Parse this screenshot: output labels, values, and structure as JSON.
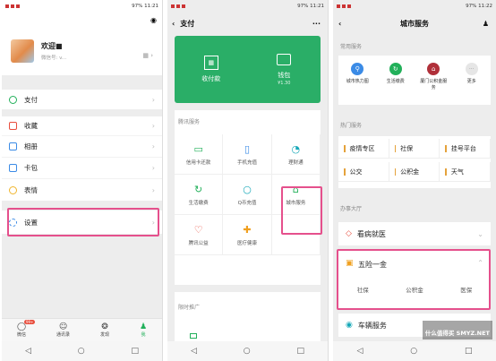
{
  "phone1": {
    "status": {
      "signal": "€☆ ⏰ ⋈ ↑",
      "battery": "97%",
      "time": "11:21"
    },
    "profile": {
      "name": "欢迎■",
      "wechat_id": "微信号: v..."
    },
    "menu": [
      {
        "label": "支付",
        "color": "#22b05a"
      },
      {
        "label": "收藏",
        "color": "#e84d3d"
      },
      {
        "label": "相册",
        "color": "#3b8be6"
      },
      {
        "label": "卡包",
        "color": "#3b8be6"
      },
      {
        "label": "表情",
        "color": "#f0b52c"
      },
      {
        "label": "设置",
        "color": "#3b8be6"
      }
    ],
    "tabs": [
      {
        "label": "微信",
        "icon": "◯",
        "badge": "99+"
      },
      {
        "label": "通讯录",
        "icon": "☺"
      },
      {
        "label": "发现",
        "icon": "❂"
      },
      {
        "label": "我",
        "icon": "♟"
      }
    ]
  },
  "phone2": {
    "status": {
      "battery": "97%",
      "time": "11:21"
    },
    "title": "支付",
    "more_icon": "···",
    "wallet": {
      "collect": "收付款",
      "wallet": "钱包",
      "balance": "¥1.30"
    },
    "section_tencent": "腾讯服务",
    "services": [
      {
        "label": "信用卡还款",
        "icon": "▭",
        "color": "#22b05a"
      },
      {
        "label": "手机充值",
        "icon": "▯",
        "color": "#3b8be6"
      },
      {
        "label": "理财通",
        "icon": "◔",
        "color": "#17a8b8"
      },
      {
        "label": "生活缴费",
        "icon": "↻",
        "color": "#22b05a"
      },
      {
        "label": "Q币充值",
        "icon": "○",
        "color": "#17a8b8"
      },
      {
        "label": "城市服务",
        "icon": "⌂",
        "color": "#22b05a"
      },
      {
        "label": "腾讯公益",
        "icon": "♡",
        "color": "#e84d3d"
      },
      {
        "label": "医疗健康",
        "icon": "✚",
        "color": "#f0a020"
      }
    ],
    "section_promo": "限时推广"
  },
  "phone3": {
    "status": {
      "battery": "97%",
      "time": "11:22"
    },
    "title": "城市服务",
    "section_common": "常用服务",
    "common": [
      {
        "label": "城市热力图",
        "color": "#3b8be6"
      },
      {
        "label": "生活缴费",
        "color": "#22b05a"
      },
      {
        "label": "厦门公积金服务",
        "color": "#b0303a"
      },
      {
        "label": "更多",
        "color": "#cccccc"
      }
    ],
    "section_hot": "热门服务",
    "hot": [
      "疫情专区",
      "社保",
      "挂号平台",
      "公交",
      "公积金",
      "天气"
    ],
    "section_hall": "办事大厅",
    "hall": [
      {
        "label": "看病就医",
        "color": "#e84d3d"
      },
      {
        "label": "五险一金",
        "color": "#f0a020"
      },
      {
        "label": "车辆服务",
        "color": "#17a8b8"
      }
    ],
    "insurance_items": [
      "社保",
      "公积金",
      "医保"
    ]
  },
  "watermark": "什么值得买 SMYZ.NET",
  "nav": {
    "back": "◁",
    "home": "○",
    "recent": "□"
  }
}
